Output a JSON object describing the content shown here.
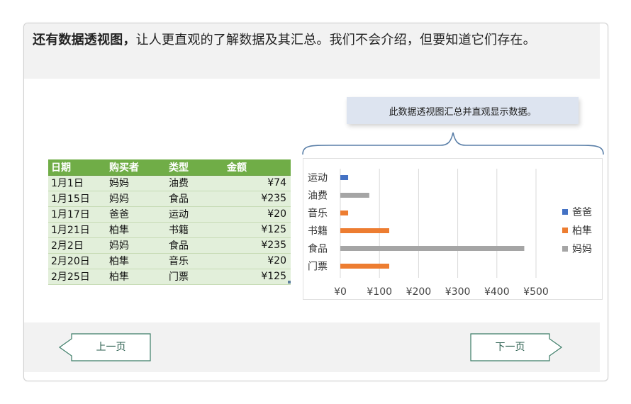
{
  "intro": {
    "bold": "还有数据透视图，",
    "rest": "让人更直观的了解数据及其汇总。我们不会介绍，但要知道它们存在。"
  },
  "table": {
    "headers": [
      "日期",
      "购买者",
      "类型",
      "金额"
    ],
    "rows": [
      [
        "1月1日",
        "妈妈",
        "油费",
        "¥74"
      ],
      [
        "1月15日",
        "妈妈",
        "食品",
        "¥235"
      ],
      [
        "1月17日",
        "爸爸",
        "运动",
        "¥20"
      ],
      [
        "1月21日",
        "柏隼",
        "书籍",
        "¥125"
      ],
      [
        "2月2日",
        "妈妈",
        "食品",
        "¥235"
      ],
      [
        "2月20日",
        "柏隼",
        "音乐",
        "¥20"
      ],
      [
        "2月25日",
        "柏隼",
        "门票",
        "¥125"
      ]
    ]
  },
  "callout": {
    "text": "此数据透视图汇总并直观显示数据。"
  },
  "chart_data": {
    "type": "bar",
    "orientation": "horizontal",
    "categories": [
      "运动",
      "油费",
      "音乐",
      "书籍",
      "食品",
      "门票"
    ],
    "series": [
      {
        "name": "爸爸",
        "color": "#4472c4",
        "values": [
          20,
          null,
          null,
          null,
          null,
          null
        ]
      },
      {
        "name": "柏隼",
        "color": "#ed7d31",
        "values": [
          null,
          null,
          20,
          125,
          null,
          125
        ]
      },
      {
        "name": "妈妈",
        "color": "#a5a5a5",
        "values": [
          null,
          74,
          null,
          null,
          470,
          null
        ]
      }
    ],
    "xticks": [
      "¥0",
      "¥100",
      "¥200",
      "¥300",
      "¥400",
      "¥500"
    ],
    "xlim": [
      0,
      500
    ],
    "grid": "vertical",
    "legend": "right"
  },
  "nav": {
    "prev": "上一页",
    "next": "下一页"
  }
}
